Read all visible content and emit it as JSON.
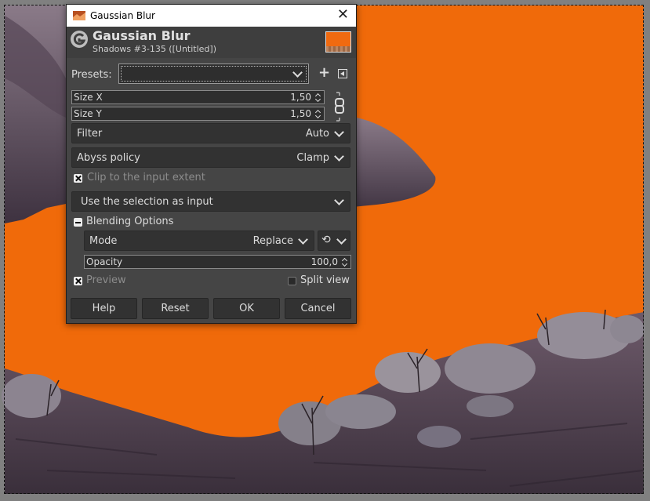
{
  "dialog": {
    "window_title": "Gaussian Blur",
    "header_title": "Gaussian Blur",
    "header_subtitle": "Shadows #3-135 ([Untitled])",
    "presets_label": "Presets:",
    "presets_value": "",
    "size_x": {
      "label": "Size X",
      "value": "1,50"
    },
    "size_y": {
      "label": "Size Y",
      "value": "1,50"
    },
    "filter": {
      "label": "Filter",
      "value": "Auto"
    },
    "abyss": {
      "label": "Abyss policy",
      "value": "Clamp"
    },
    "clip_label": "Clip to the input extent",
    "selection_label": "Use the selection as input",
    "blending_label": "Blending Options",
    "mode": {
      "label": "Mode",
      "value": "Replace"
    },
    "opacity": {
      "label": "Opacity",
      "value": "100,0"
    },
    "preview_label": "Preview",
    "split_view_label": "Split view",
    "buttons": {
      "help": "Help",
      "reset": "Reset",
      "ok": "OK",
      "cancel": "Cancel"
    }
  },
  "colors": {
    "canvas_fill": "#f06a0a",
    "dialog_bg": "#454545",
    "rock": "#6b5a68"
  }
}
